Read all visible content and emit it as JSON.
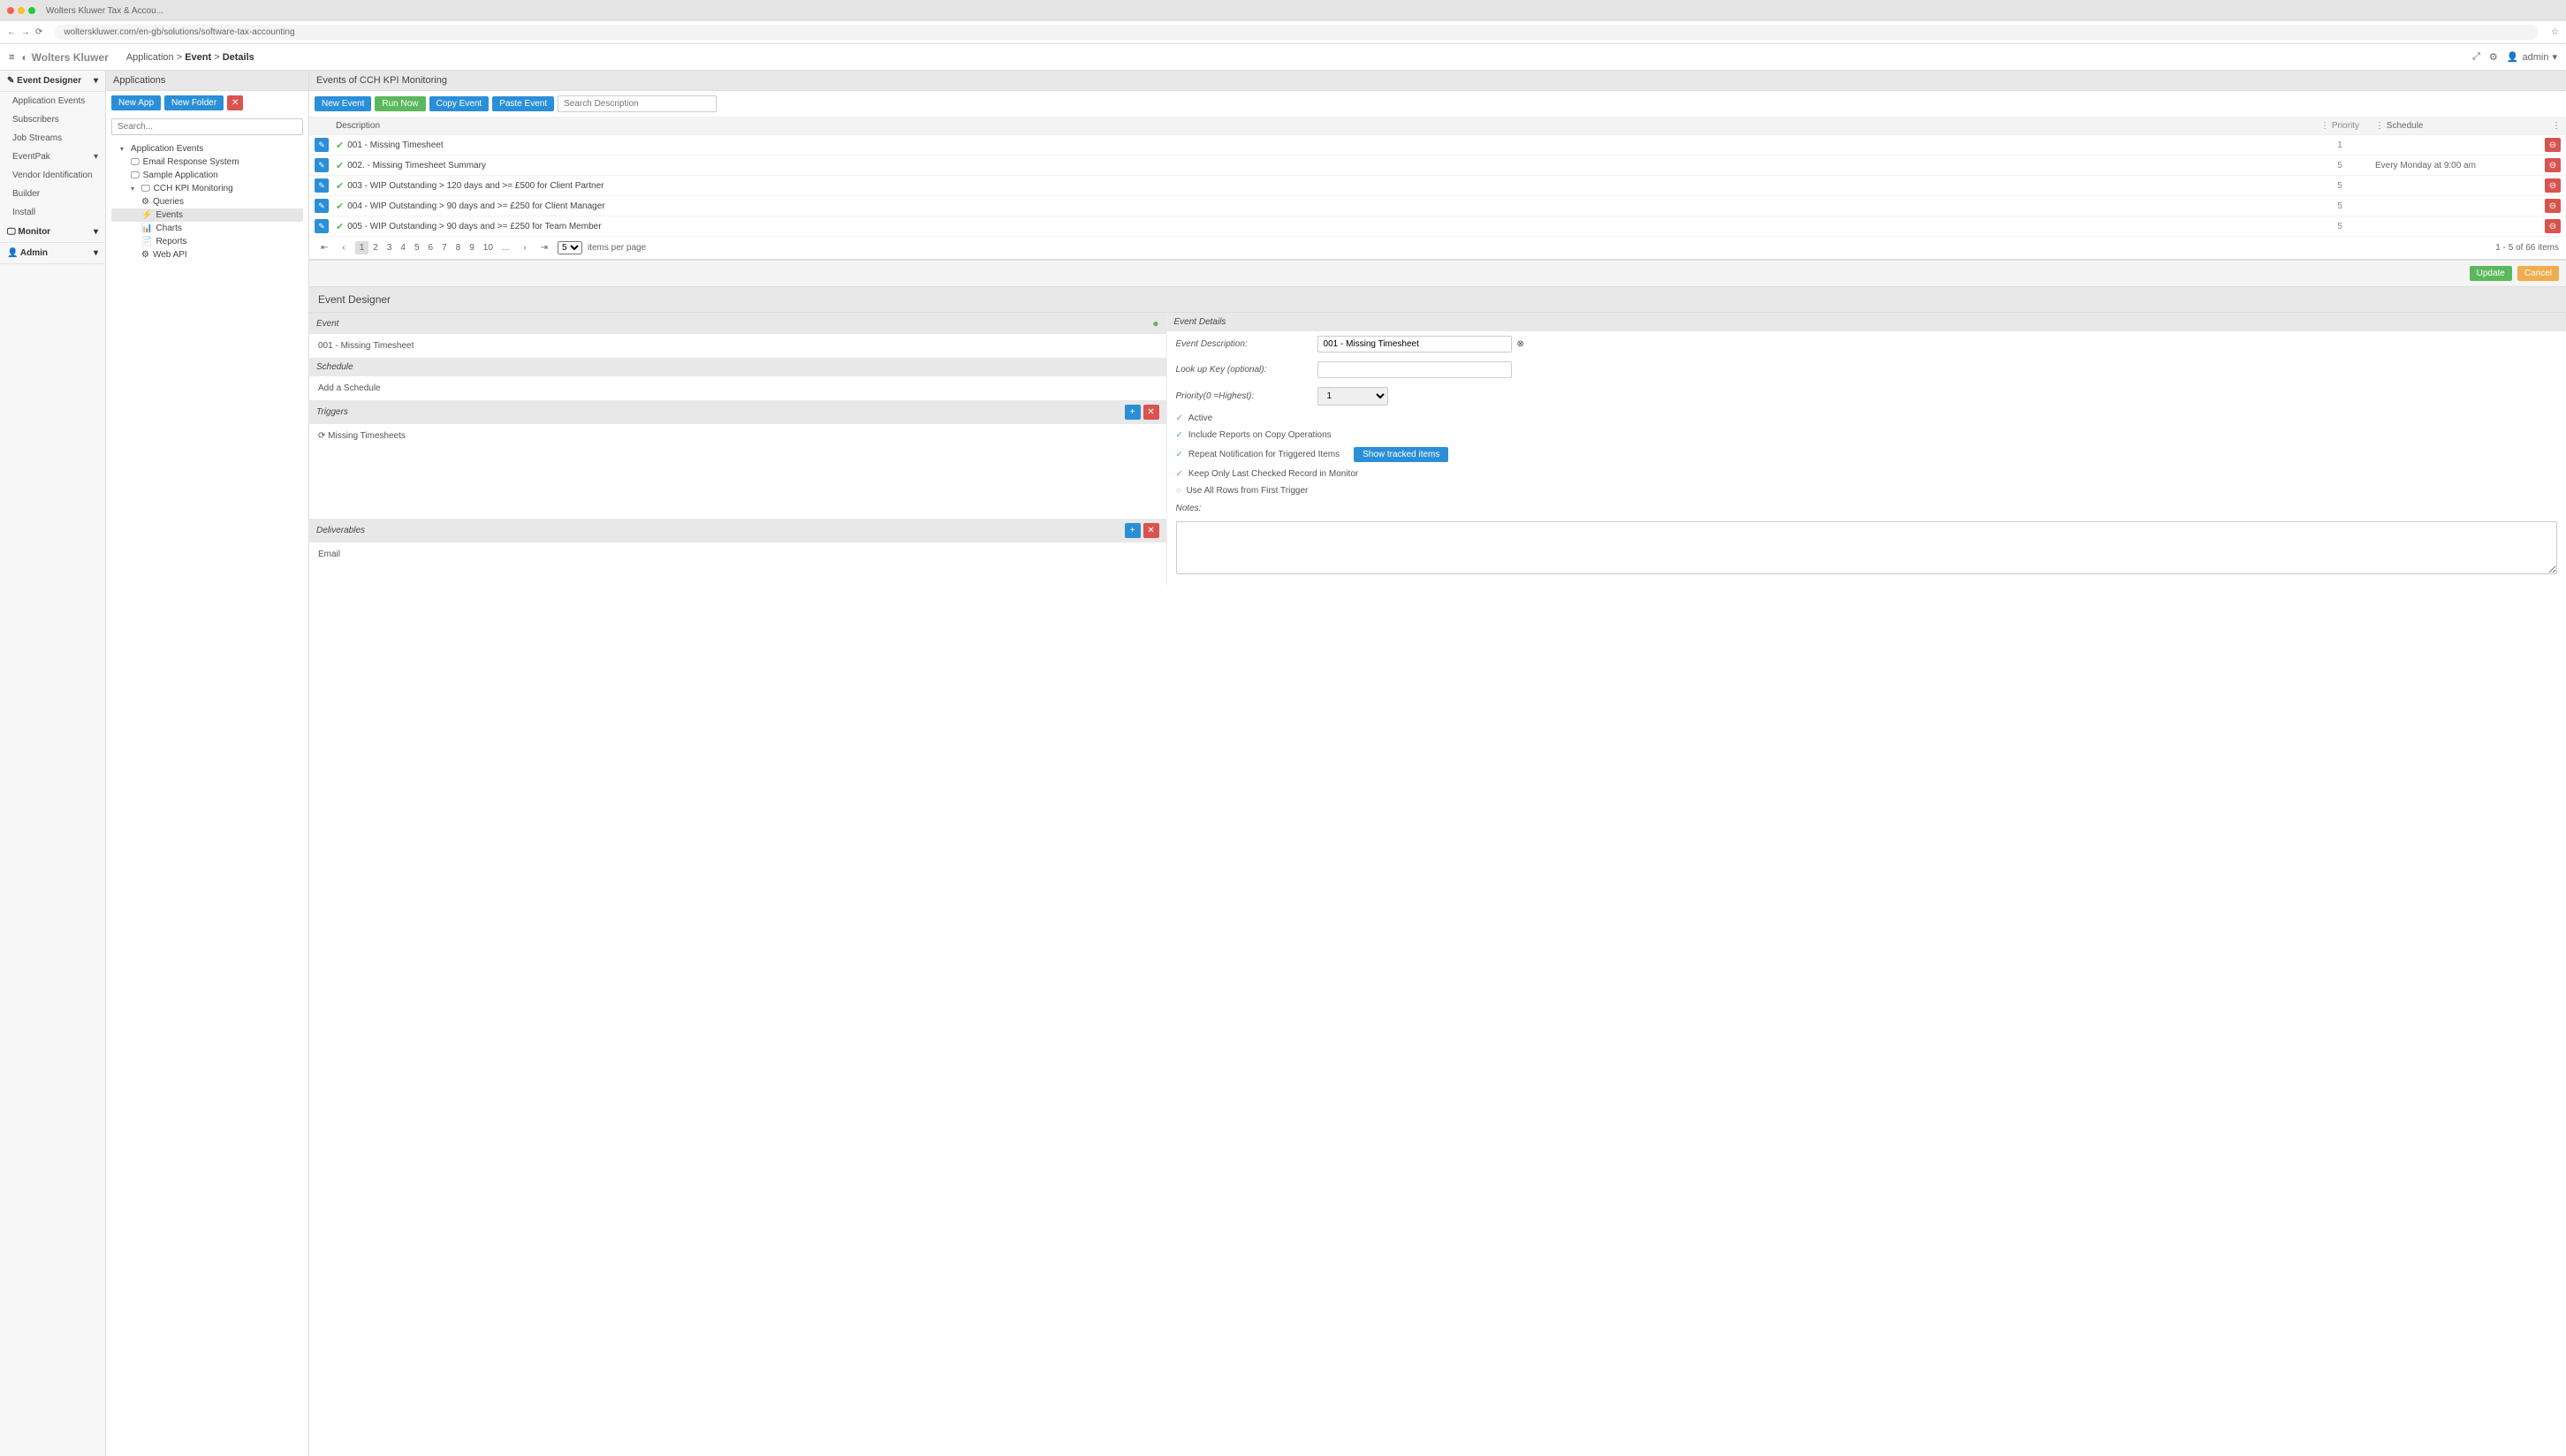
{
  "browser": {
    "tab_title": "Wolters Kluwer Tax & Accou...",
    "url": "wolterskluwer.com/en-gb/solutions/software-tax-accounting",
    "star": "☆"
  },
  "header": {
    "brand": "Wolters Kluwer",
    "breadcrumb_app": "Application",
    "breadcrumb_event": "Event",
    "breadcrumb_details": "Details",
    "user": "admin"
  },
  "sidebar": {
    "groups": [
      {
        "label": "Event Designer",
        "expandable": true
      },
      {
        "label": "Monitor",
        "expandable": true
      },
      {
        "label": "Admin",
        "expandable": true
      }
    ],
    "designer_items": [
      "Application Events",
      "Subscribers",
      "Job Streams",
      "EventPak",
      "Vendor Identification",
      "Builder",
      "Install"
    ]
  },
  "apps": {
    "title": "Applications",
    "new_app": "New App",
    "new_folder": "New Folder",
    "search_ph": "Search...",
    "tree_root": "Application Events",
    "tree_items": [
      {
        "label": "Email Response System",
        "icon": "🖵"
      },
      {
        "label": "Sample Application",
        "icon": "🖵"
      },
      {
        "label": "CCH KPI Monitoring",
        "icon": "🖵",
        "expanded": true
      }
    ],
    "kpi_children": [
      {
        "label": "Queries",
        "icon": "⚙"
      },
      {
        "label": "Events",
        "icon": "⚡",
        "selected": true
      },
      {
        "label": "Charts",
        "icon": "📊"
      },
      {
        "label": "Reports",
        "icon": "📄"
      },
      {
        "label": "Web API",
        "icon": "⚙"
      }
    ]
  },
  "events": {
    "title": "Events of CCH KPI Monitoring",
    "btn_new": "New Event",
    "btn_run": "Run Now",
    "btn_copy": "Copy Event",
    "btn_paste": "Paste Event",
    "search_ph": "Search Description",
    "cols": {
      "desc": "Description",
      "pri": "Priority",
      "sched": "Schedule"
    },
    "rows": [
      {
        "desc": "001 - Missing Timesheet",
        "pri": "1",
        "sched": ""
      },
      {
        "desc": "002. - Missing Timesheet Summary",
        "pri": "5",
        "sched": "Every Monday at 9:00 am"
      },
      {
        "desc": "003 - WIP Outstanding > 120 days and >= £500 for Client Partner",
        "pri": "5",
        "sched": ""
      },
      {
        "desc": "004 - WIP Outstanding > 90 days and >= £250 for Client Manager",
        "pri": "5",
        "sched": ""
      },
      {
        "desc": "005 - WIP Outstanding > 90 days and >= £250 for Team Member",
        "pri": "5",
        "sched": ""
      }
    ],
    "pager": {
      "pages": [
        "1",
        "2",
        "3",
        "4",
        "5",
        "6",
        "7",
        "8",
        "9",
        "10",
        "..."
      ],
      "size": "5",
      "ipp": "items per page",
      "info": "1 - 5 of 66 items"
    }
  },
  "designer": {
    "title": "Event Designer",
    "update": "Update",
    "cancel": "Cancel",
    "left": {
      "event_hd": "Event",
      "event_val": "001 - Missing Timesheet",
      "schedule_hd": "Schedule",
      "schedule_val": "Add a Schedule",
      "triggers_hd": "Triggers",
      "trigger_item": "Missing Timesheets",
      "deliverables_hd": "Deliverables",
      "deliverable_item": "Email"
    },
    "right": {
      "details_hd": "Event Details",
      "desc_lbl": "Event Description:",
      "desc_val": "001 - Missing Timesheet",
      "lookup_lbl": "Look up Key (optional):",
      "lookup_val": "",
      "priority_lbl": "Priority(0 =Highest):",
      "priority_val": "1",
      "chk_active": "Active",
      "chk_include": "Include Reports on Copy Operations",
      "chk_repeat": "Repeat Notification for Triggered Items",
      "show_tracked": "Show tracked items",
      "chk_keep": "Keep Only Last Checked Record in Monitor",
      "chk_useall": "Use All Rows from First Trigger",
      "notes_lbl": "Notes:"
    }
  }
}
